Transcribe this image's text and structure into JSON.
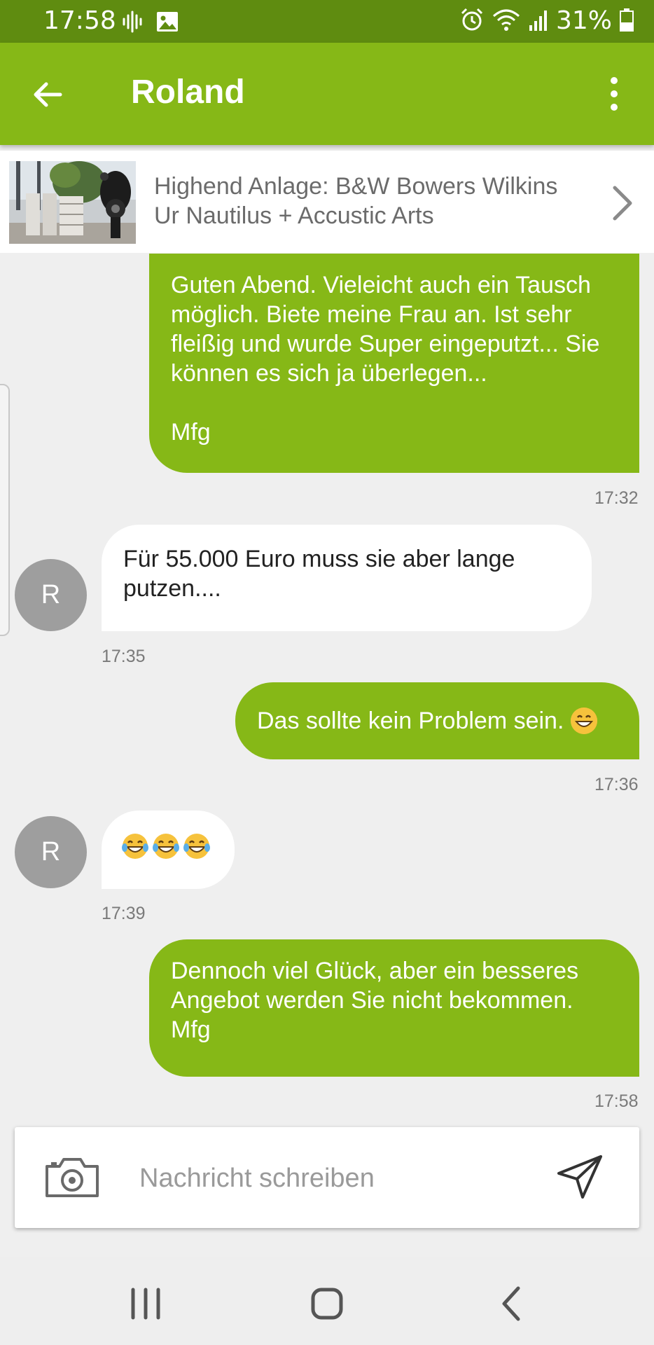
{
  "status_bar": {
    "time": "17:58",
    "battery_percent": "31%",
    "icons": [
      "voicemail-icon",
      "image-icon",
      "alarm-icon",
      "wifi-icon",
      "signal-icon",
      "battery-icon"
    ]
  },
  "app_bar": {
    "title": "Roland",
    "back_icon": "arrow-left-icon",
    "menu_icon": "more-vertical-icon"
  },
  "listing": {
    "title": "Highend Anlage: B&W Bowers Wilkins Ur Nautilus + Accustic Arts",
    "chevron_icon": "chevron-right-icon"
  },
  "messages": [
    {
      "direction": "out",
      "text": "Guten Abend. Vieleicht auch ein Tausch möglich. Biete meine Frau an. Ist sehr fleißig und wurde Super eingeputzt... Sie können es sich ja überlegen...\n\nMfg",
      "time": "17:32"
    },
    {
      "direction": "in",
      "avatar": "R",
      "text": "Für 55.000 Euro muss sie aber lange putzen....",
      "time": "17:35"
    },
    {
      "direction": "out",
      "text": "Das sollte kein Problem sein.",
      "emoji": "grinning-face-emoji",
      "time": "17:36"
    },
    {
      "direction": "in",
      "avatar": "R",
      "emoji": [
        "tears-of-joy-emoji",
        "tears-of-joy-emoji",
        "tears-of-joy-emoji"
      ],
      "time": "17:39"
    },
    {
      "direction": "out",
      "text": "Dennoch viel Glück, aber ein besseres Angebot werden Sie nicht bekommen. Mfg",
      "time": "17:58"
    }
  ],
  "composer": {
    "placeholder": "Nachricht schreiben",
    "camera_icon": "camera-icon",
    "send_icon": "send-icon"
  },
  "nav_bar": {
    "icons": [
      "recent-apps-icon",
      "home-icon",
      "back-icon"
    ]
  },
  "colors": {
    "status_bar": "#5f8c10",
    "accent": "#86b817",
    "background": "#efefef",
    "incoming_bubble": "#ffffff",
    "avatar": "#9e9e9e"
  }
}
